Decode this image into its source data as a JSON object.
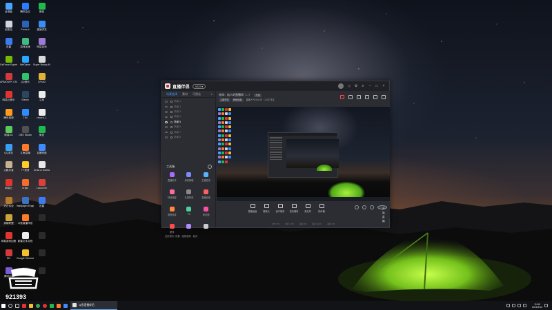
{
  "desktop": {
    "icons": [
      {
        "label": "此电脑",
        "color": "#4aa3ff"
      },
      {
        "label": "腾讯会议",
        "color": "#2f7bff"
      },
      {
        "label": "微信",
        "color": "#1fba4c"
      },
      {
        "label": "回收站",
        "color": "#cfd6df"
      },
      {
        "label": "Forza 4",
        "color": "#2b63b8"
      },
      {
        "label": "极速浏览",
        "color": "#3a8df5"
      },
      {
        "label": "迅雷",
        "color": "#3b7cf2"
      },
      {
        "label": "游戏加速",
        "color": "#42b883"
      },
      {
        "label": "网易游戏",
        "color": "#9b7bd4"
      },
      {
        "label": "GeForce Experience",
        "color": "#76b900"
      },
      {
        "label": "WeGame",
        "color": "#2aa7ff"
      },
      {
        "label": "Super Bunny Man",
        "color": "#d9d9d9"
      },
      {
        "label": "ARMOURY CRATE",
        "color": "#d13b3b"
      },
      {
        "label": "QQ音乐",
        "color": "#33c36a"
      },
      {
        "label": "CPUID",
        "color": "#e0b23a"
      },
      {
        "label": "网易云音乐",
        "color": "#e0342f"
      },
      {
        "label": "Steam",
        "color": "#2a475e"
      },
      {
        "label": "文档",
        "color": "#ececec"
      },
      {
        "label": "腾讯视频",
        "color": "#ff9a1f"
      },
      {
        "label": "TIM",
        "color": "#2f8cff"
      },
      {
        "label": "record_1",
        "color": "#ececec"
      },
      {
        "label": "网易UU",
        "color": "#5bc95b"
      },
      {
        "label": "OBS Studio",
        "color": "#505050"
      },
      {
        "label": "微信",
        "color": "#1fba4c"
      },
      {
        "label": "QQ浏览",
        "color": "#37a0f5"
      },
      {
        "label": "斗鱼直播",
        "color": "#ff7a2b"
      },
      {
        "label": "百度网盘",
        "color": "#3d8bff"
      },
      {
        "label": "火影忍者",
        "color": "#c8b190"
      },
      {
        "label": "YY语音",
        "color": "#ffcc2b"
      },
      {
        "label": "Draw & Guess",
        "color": "#e8e8e8"
      },
      {
        "label": "网易云",
        "color": "#e0342f"
      },
      {
        "label": "Origin",
        "color": "#f56c2d"
      },
      {
        "label": "Launcher",
        "color": "#d9423a"
      },
      {
        "label": "炉石传说",
        "color": "#b67a2e"
      },
      {
        "label": "Wallpaper Engine",
        "color": "#3a74c4"
      },
      {
        "label": "迅雷",
        "color": "#3b7cf2"
      },
      {
        "label": "英雄联盟",
        "color": "#c9a53c"
      },
      {
        "label": "斗鱼直播伴侣",
        "color": "#ff7a2b"
      },
      {
        "label": "",
        "color": "#2b2b2b"
      },
      {
        "label": "网易游戏加速",
        "color": "#e0342f"
      },
      {
        "label": "新建文本文档",
        "color": "#ececec"
      },
      {
        "label": "",
        "color": "#2b2b2b"
      },
      {
        "label": "KD",
        "color": "#d13b3b"
      },
      {
        "label": "Google Chrome",
        "color": "#f2c030"
      },
      {
        "label": "",
        "color": "#2b2b2b"
      },
      {
        "label": "腾讯QQ",
        "color": "#7b5bd4"
      },
      {
        "label": "",
        "color": "#2b2b2b"
      },
      {
        "label": "",
        "color": "#2b2b2b"
      }
    ]
  },
  "watermark": {
    "number": "921393"
  },
  "app": {
    "title": "直播伴侣",
    "version": "V5.0 ▾",
    "tabs": [
      "场景选择",
      "素材",
      "可视化"
    ],
    "active_tab": 0,
    "add_scene": "+",
    "scenes": [
      {
        "label": "场景 1",
        "active": false
      },
      {
        "label": "场景 2",
        "active": false
      },
      {
        "label": "场景 3",
        "active": false
      },
      {
        "label": "场景 4",
        "active": false
      },
      {
        "label": "场景 5",
        "active": true
      },
      {
        "label": "场景 6",
        "active": false
      },
      {
        "label": "场景 7",
        "active": false
      },
      {
        "label": "场景 8",
        "active": false
      }
    ],
    "toolbox_title": "工具箱",
    "tools": [
      {
        "label": "直播助手",
        "color": "#a66bff"
      },
      {
        "label": "房间管理",
        "color": "#7a8cff"
      },
      {
        "label": "主播任务",
        "color": "#5ab2ff"
      },
      {
        "label": "特效弹幕",
        "color": "#ff6aa0"
      },
      {
        "label": "礼物特效",
        "color": "#8a8a8a"
      },
      {
        "label": "直播回放",
        "color": "#ff5f5f"
      },
      {
        "label": "语音连麦",
        "color": "#ff8a3d"
      },
      {
        "label": "PK",
        "color": "#4bd1a0"
      },
      {
        "label": "粉丝团",
        "color": "#ff4fa0"
      },
      {
        "label": "更多",
        "color": "#ff4a4a"
      },
      {
        "label": "",
        "color": "#b08aff"
      },
      {
        "label": "",
        "color": "#cccccc"
      }
    ],
    "tips": "友情提示: 设置 · 画质选择 · 高清",
    "room": {
      "title": "房间：仙人的直播间（...）",
      "tag": "分区",
      "chips": [
        "主播任务",
        "房间设置"
      ],
      "stat": "直播人气 521.0K  ·  1.4万 关注"
    },
    "controls": [
      {
        "label": "直播画面"
      },
      {
        "label": "摄像头"
      },
      {
        "label": "窗口捕获"
      },
      {
        "label": "游戏捕获"
      },
      {
        "label": "麦克风"
      },
      {
        "label": "扬声器"
      }
    ],
    "start_button": "开始直播",
    "status": [
      "CPU: 5%",
      "内存: 40%",
      "帧率: 60",
      "码率: 0kb/s",
      "丢帧: 0%"
    ]
  },
  "taskbar": {
    "task_label": "斗鱼直播伴侣",
    "time": "11:58",
    "date": "2021/9/13"
  }
}
